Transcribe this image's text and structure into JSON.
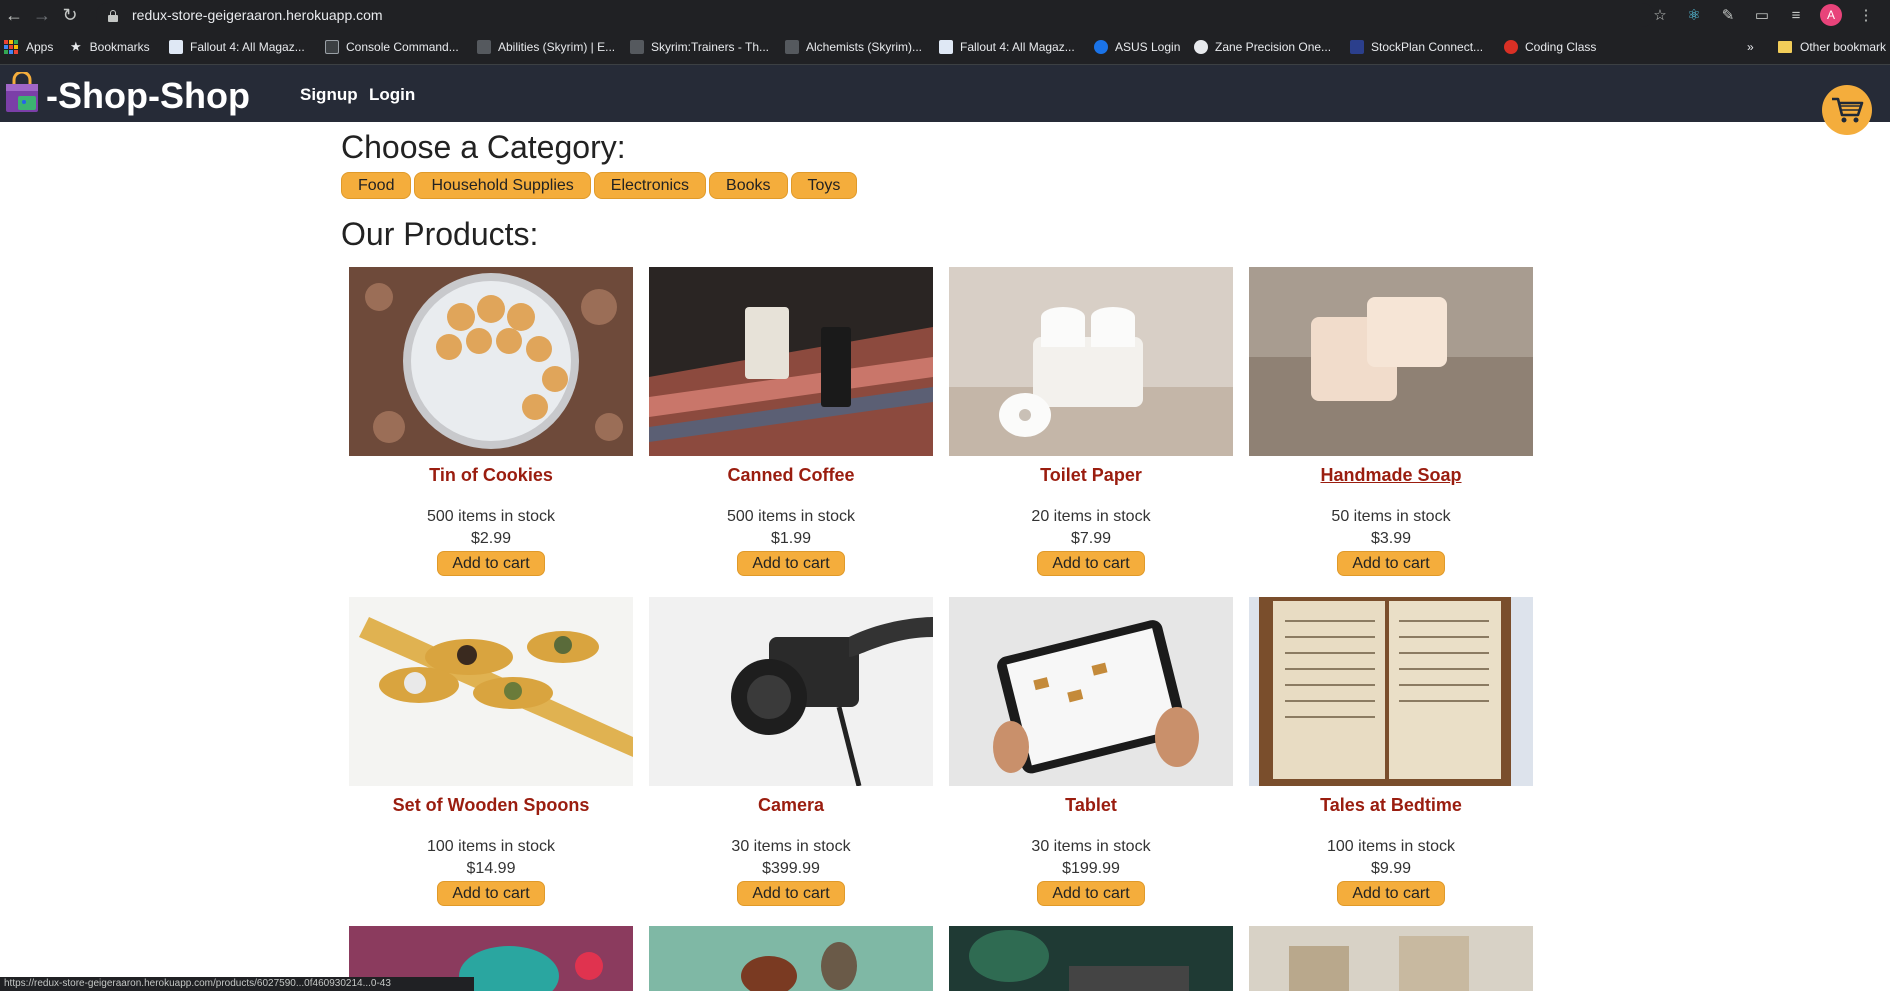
{
  "browser": {
    "url": "redux-store-geigeraaron.herokuapp.com",
    "profile_initial": "A",
    "status_url": "https://redux-store-geigeraaron.herokuapp.com/products/6027590...0f460930214...0-43"
  },
  "bookmarks": [
    {
      "label": "Apps",
      "icon": "apps-grid-icon"
    },
    {
      "label": "Bookmarks",
      "icon": "star-icon"
    },
    {
      "label": "Fallout 4: All Magaz...",
      "icon": "site-icon"
    },
    {
      "label": "Console Command...",
      "icon": "page-icon"
    },
    {
      "label": "Abilities (Skyrim) | E...",
      "icon": "site-icon"
    },
    {
      "label": "Skyrim:Trainers - Th...",
      "icon": "site-icon"
    },
    {
      "label": "Alchemists (Skyrim)...",
      "icon": "site-icon"
    },
    {
      "label": "Fallout 4: All Magaz...",
      "icon": "site-icon"
    },
    {
      "label": "ASUS Login",
      "icon": "router-icon"
    },
    {
      "label": "Zane Precision One...",
      "icon": "site-icon"
    },
    {
      "label": "StockPlan Connect...",
      "icon": "site-icon"
    },
    {
      "label": "Coding Class",
      "icon": "site-icon"
    },
    {
      "label": "Other bookmark",
      "icon": "folder-icon"
    }
  ],
  "header": {
    "brand": "-Shop-Shop",
    "signup": "Signup",
    "login": "Login"
  },
  "categories_title": "Choose a Category:",
  "categories": [
    "Food",
    "Household Supplies",
    "Electronics",
    "Books",
    "Toys"
  ],
  "products_title": "Our Products:",
  "add_label": "Add to cart",
  "products": [
    {
      "name": "Tin of Cookies",
      "stock": "500 items in stock",
      "price": "$2.99"
    },
    {
      "name": "Canned Coffee",
      "stock": "500 items in stock",
      "price": "$1.99"
    },
    {
      "name": "Toilet Paper",
      "stock": "20 items in stock",
      "price": "$7.99"
    },
    {
      "name": "Handmade Soap",
      "stock": "50 items in stock",
      "price": "$3.99"
    },
    {
      "name": "Set of Wooden Spoons",
      "stock": "100 items in stock",
      "price": "$14.99"
    },
    {
      "name": "Camera",
      "stock": "30 items in stock",
      "price": "$399.99"
    },
    {
      "name": "Tablet",
      "stock": "30 items in stock",
      "price": "$199.99"
    },
    {
      "name": "Tales at Bedtime",
      "stock": "100 items in stock",
      "price": "$9.99"
    }
  ],
  "colors": {
    "header_bg": "#262b37",
    "accent": "#f4ad3c",
    "product_name": "#9a1d0f"
  }
}
